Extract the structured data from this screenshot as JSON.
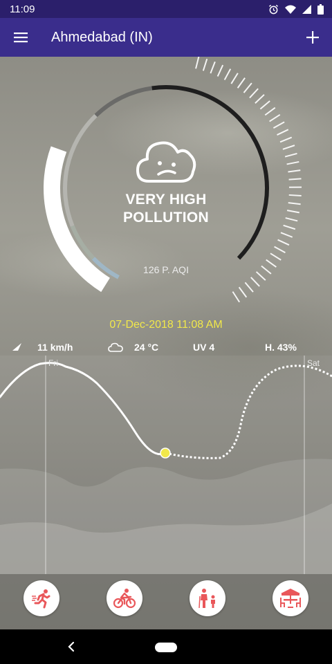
{
  "status_bar": {
    "time": "11:09",
    "icons": [
      "alarm-icon",
      "wifi-icon",
      "signal-icon",
      "battery-icon"
    ]
  },
  "app_bar": {
    "title": "Ahmedabad (IN)",
    "icons": [
      "menu-icon",
      "add-icon"
    ]
  },
  "gauge": {
    "status_line1": "VERY HIGH",
    "status_line2": "POLLUTION",
    "aqi_label": "126 P. AQI",
    "face_icon": "sad-cloud-icon"
  },
  "datetime": "07-Dec-2018 11:08 AM",
  "weather": {
    "wind": "11 km/h",
    "temperature": "24 °C",
    "uv": "UV 4",
    "humidity": "H. 43%"
  },
  "forecast": {
    "day_labels": [
      "Fri",
      "Sat"
    ]
  },
  "activities": [
    {
      "name": "running",
      "icon": "running-icon"
    },
    {
      "name": "cycling",
      "icon": "cycling-icon"
    },
    {
      "name": "elderly-and-children",
      "icon": "family-icon"
    },
    {
      "name": "outdoor-dining",
      "icon": "table-umbrella-icon"
    }
  ],
  "colors": {
    "status_bar": "#2b1f6b",
    "app_bar": "#3a2d8c",
    "date_text": "#f1e84a",
    "activity_icon": "#e9575a",
    "current_point": "#f1e84a"
  }
}
